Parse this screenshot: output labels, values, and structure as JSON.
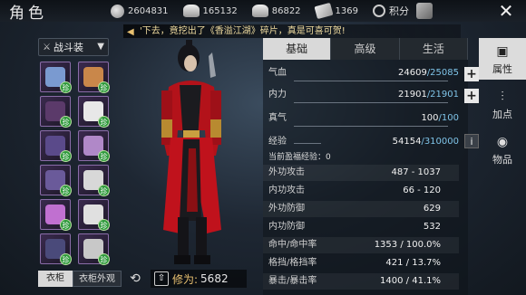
{
  "header": {
    "title": "角色",
    "currencies": [
      {
        "icon": "coin-icon",
        "value": "2604831"
      },
      {
        "icon": "silver-ingot-icon",
        "value": "165132"
      },
      {
        "icon": "ingot-icon",
        "value": "86822"
      },
      {
        "icon": "card-icon",
        "value": "1369"
      }
    ],
    "points_label": "积分",
    "close_label": "✕"
  },
  "notice": {
    "text": "'下去，竟挖出了《香溢江湖》碎片，真是可喜可贺!"
  },
  "equipment": {
    "set_label": "战斗装",
    "badge": "珍",
    "slots": [
      {
        "name": "weapon-slot",
        "color": "#7a9ad0",
        "badge": true
      },
      {
        "name": "flute-slot",
        "color": "#c9874a",
        "badge": true
      },
      {
        "name": "hair-slot",
        "color": "#5b3a6a",
        "badge": true
      },
      {
        "name": "ornament-slot",
        "color": "#e8e8e8",
        "badge": true
      },
      {
        "name": "armor-slot",
        "color": "#5a4a8a",
        "badge": true
      },
      {
        "name": "fan-slot",
        "color": "#b088c8",
        "badge": true
      },
      {
        "name": "belt-slot",
        "color": "#6a5a9a",
        "badge": true
      },
      {
        "name": "bracelet-slot",
        "color": "#d8d8d8",
        "badge": true
      },
      {
        "name": "bracer-slot",
        "color": "#c070d0",
        "badge": true
      },
      {
        "name": "ring-slot",
        "color": "#e0e0e0",
        "badge": true
      },
      {
        "name": "boots-slot",
        "color": "#4a4a7a",
        "badge": true
      },
      {
        "name": "necklace-slot",
        "color": "#c8c8c8",
        "badge": true
      }
    ],
    "tab_wardrobe": "衣柜",
    "tab_outfit": "衣柜外观",
    "cultivation_label": "修为:",
    "cultivation_value": "5682"
  },
  "stats": {
    "tabs": [
      "基础",
      "高级",
      "生活"
    ],
    "hp": {
      "label": "气血",
      "current": "24609",
      "max": "/25085"
    },
    "mp": {
      "label": "内力",
      "current": "21901",
      "max": "/21901"
    },
    "qi": {
      "label": "真气",
      "current": "100",
      "max": "/100"
    },
    "exp": {
      "label": "经验",
      "current": "54154",
      "max": "/310000"
    },
    "exp_bonus": "当前盈福经验：0",
    "rows": [
      {
        "label": "外功攻击",
        "value": "487 - 1037"
      },
      {
        "label": "内功攻击",
        "value": "66 - 120"
      },
      {
        "label": "外功防御",
        "value": "629"
      },
      {
        "label": "内功防御",
        "value": "532"
      },
      {
        "label": "命中/命中率",
        "value": "1353 / 100.0%"
      },
      {
        "label": "格挡/格挡率",
        "value": "421 / 13.7%"
      },
      {
        "label": "暴击/暴击率",
        "value": "1400 / 41.1%"
      }
    ]
  },
  "side_nav": [
    {
      "label": "属性",
      "icon": "attributes-icon"
    },
    {
      "label": "加点",
      "icon": "sliders-icon"
    },
    {
      "label": "物品",
      "icon": "bag-icon"
    }
  ]
}
